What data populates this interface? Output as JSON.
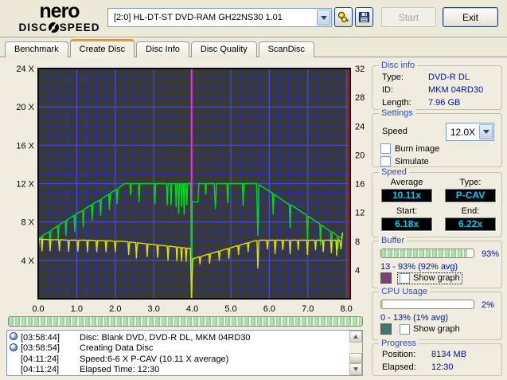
{
  "titlebar": {
    "brand": "nero",
    "product_left": "DISC",
    "product_right": "SPEED",
    "drive_selector": "[2:0]   HL-DT-ST DVD-RAM GH22NS30 1.01",
    "start_button": "Start",
    "exit_button": "Exit"
  },
  "tabs": [
    {
      "label": "Benchmark",
      "active": false
    },
    {
      "label": "Create Disc",
      "active": true
    },
    {
      "label": "Disc Info",
      "active": false
    },
    {
      "label": "Disc Quality",
      "active": false
    },
    {
      "label": "ScanDisc",
      "active": false
    }
  ],
  "chart_data": {
    "type": "line",
    "title": "",
    "x_axis": {
      "min": 0,
      "max": 8.1,
      "minor_step": 0.25,
      "major_step": 1,
      "ticks": [
        {
          "v": 0,
          "label": "0.0"
        },
        {
          "v": 1,
          "label": "1.0"
        },
        {
          "v": 2,
          "label": "2.0"
        },
        {
          "v": 3,
          "label": "3.0"
        },
        {
          "v": 4,
          "label": "4.0"
        },
        {
          "v": 5,
          "label": "5.0"
        },
        {
          "v": 6,
          "label": "6.0"
        },
        {
          "v": 7,
          "label": "7.0"
        },
        {
          "v": 8,
          "label": "8.0"
        }
      ]
    },
    "y_left_axis": {
      "min": 0,
      "max": 24,
      "minor_step": 1,
      "major_step": 4,
      "ticks": [
        {
          "v": 4,
          "label": "4 X"
        },
        {
          "v": 8,
          "label": "8 X"
        },
        {
          "v": 12,
          "label": "12 X"
        },
        {
          "v": 16,
          "label": "16 X"
        },
        {
          "v": 20,
          "label": "20 X"
        },
        {
          "v": 24,
          "label": "24 X"
        }
      ]
    },
    "y_right_axis": {
      "min": 0,
      "max": 32,
      "ticks": [
        {
          "v": 4,
          "label": "4"
        },
        {
          "v": 8,
          "label": "8"
        },
        {
          "v": 12,
          "label": "12"
        },
        {
          "v": 16,
          "label": "16"
        },
        {
          "v": 20,
          "label": "20"
        },
        {
          "v": 24,
          "label": "24"
        },
        {
          "v": 28,
          "label": "28"
        },
        {
          "v": 32,
          "label": "32"
        }
      ]
    },
    "grid": {
      "bg": "#3a3a35",
      "minor_color": "#2230b4",
      "major_color": "#3d4cf0",
      "border_color": "#05051e"
    },
    "markers": [
      {
        "name": "layer-break-line",
        "x": 3.98,
        "color": "#ff2ed8"
      },
      {
        "name": "end-of-disc-line",
        "x": 8.06,
        "color": "#dd1111"
      }
    ],
    "series": [
      {
        "name": "write-speed-x",
        "color": "#00dc14",
        "axis": "left",
        "points": [
          [
            0.0,
            5.0
          ],
          [
            0.03,
            6.3
          ],
          [
            0.08,
            6.5
          ],
          [
            0.1,
            5.4
          ],
          [
            0.12,
            6.6
          ],
          [
            0.29,
            7.0
          ],
          [
            0.31,
            5.7
          ],
          [
            0.33,
            7.1
          ],
          [
            0.5,
            7.6
          ],
          [
            0.52,
            6.1
          ],
          [
            0.54,
            7.7
          ],
          [
            0.7,
            8.1
          ],
          [
            0.72,
            6.6
          ],
          [
            0.74,
            8.2
          ],
          [
            0.93,
            8.7
          ],
          [
            0.95,
            7.0
          ],
          [
            0.97,
            8.8
          ],
          [
            1.15,
            9.2
          ],
          [
            1.17,
            7.5
          ],
          [
            1.19,
            9.3
          ],
          [
            1.38,
            9.8
          ],
          [
            1.4,
            8.2
          ],
          [
            1.42,
            9.9
          ],
          [
            1.6,
            10.3
          ],
          [
            1.62,
            8.7
          ],
          [
            1.64,
            10.4
          ],
          [
            1.83,
            10.9
          ],
          [
            1.85,
            9.3
          ],
          [
            1.87,
            11.0
          ],
          [
            2.03,
            11.4
          ],
          [
            2.05,
            9.9
          ],
          [
            2.07,
            11.5
          ],
          [
            2.25,
            12
          ],
          [
            2.38,
            12
          ],
          [
            2.4,
            10.8
          ],
          [
            2.42,
            12
          ],
          [
            2.6,
            12
          ],
          [
            2.62,
            10.1
          ],
          [
            2.64,
            12
          ],
          [
            3.01,
            12
          ],
          [
            3.03,
            9.9
          ],
          [
            3.05,
            12
          ],
          [
            3.33,
            12
          ],
          [
            3.35,
            9.8
          ],
          [
            3.37,
            12
          ],
          [
            3.43,
            12
          ],
          [
            3.45,
            9.8
          ],
          [
            3.47,
            12
          ],
          [
            3.56,
            12
          ],
          [
            3.58,
            9.6
          ],
          [
            3.6,
            12
          ],
          [
            3.63,
            12
          ],
          [
            3.65,
            8.9
          ],
          [
            3.67,
            12
          ],
          [
            3.7,
            12
          ],
          [
            3.72,
            9.6
          ],
          [
            3.74,
            12
          ],
          [
            3.77,
            12
          ],
          [
            3.79,
            8.8
          ],
          [
            3.81,
            12
          ],
          [
            3.84,
            12
          ],
          [
            3.86,
            9.8
          ],
          [
            3.88,
            12
          ],
          [
            3.96,
            12
          ],
          [
            3.98,
            0.2
          ],
          [
            4.0,
            10.1
          ],
          [
            4.15,
            10.1
          ],
          [
            4.17,
            12
          ],
          [
            4.33,
            12
          ],
          [
            4.35,
            10.9
          ],
          [
            4.37,
            12
          ],
          [
            4.57,
            12
          ],
          [
            4.6,
            9.4
          ],
          [
            4.63,
            12
          ],
          [
            4.9,
            12
          ],
          [
            4.92,
            10.0
          ],
          [
            4.94,
            12
          ],
          [
            5.3,
            12
          ],
          [
            5.32,
            9.7
          ],
          [
            5.34,
            12
          ],
          [
            5.67,
            12
          ],
          [
            5.7,
            6.6
          ],
          [
            5.73,
            11.9
          ],
          [
            6.08,
            11.0
          ],
          [
            6.1,
            8.8
          ],
          [
            6.12,
            10.9
          ],
          [
            6.52,
            9.8
          ],
          [
            6.54,
            7.4
          ],
          [
            6.56,
            9.8
          ],
          [
            6.97,
            8.7
          ],
          [
            6.99,
            6.1
          ],
          [
            7.01,
            8.6
          ],
          [
            7.31,
            7.8
          ],
          [
            7.33,
            5.6
          ],
          [
            7.35,
            7.7
          ],
          [
            7.59,
            7.0
          ],
          [
            7.61,
            5.2
          ],
          [
            7.63,
            7.0
          ],
          [
            7.76,
            6.6
          ],
          [
            7.78,
            5.2
          ],
          [
            7.8,
            6.5
          ],
          [
            7.87,
            6.3
          ],
          [
            7.9,
            6.8
          ]
        ]
      },
      {
        "name": "rotation-speed",
        "color": "#e0e000",
        "axis": "left",
        "points": [
          [
            0.0,
            4.9
          ],
          [
            0.02,
            6.2
          ],
          [
            0.08,
            6.2
          ],
          [
            0.1,
            5.0
          ],
          [
            0.12,
            6.2
          ],
          [
            0.29,
            6.15
          ],
          [
            0.31,
            5.0
          ],
          [
            0.33,
            6.15
          ],
          [
            0.53,
            6.15
          ],
          [
            0.55,
            5.0
          ],
          [
            0.57,
            6.15
          ],
          [
            0.77,
            6.1
          ],
          [
            0.79,
            4.95
          ],
          [
            0.81,
            6.1
          ],
          [
            1.01,
            6.1
          ],
          [
            1.03,
            4.95
          ],
          [
            1.05,
            6.1
          ],
          [
            1.26,
            6.1
          ],
          [
            1.28,
            4.9
          ],
          [
            1.3,
            6.1
          ],
          [
            1.5,
            6.05
          ],
          [
            1.52,
            4.9
          ],
          [
            1.54,
            6.05
          ],
          [
            1.74,
            6.05
          ],
          [
            1.76,
            4.9
          ],
          [
            1.78,
            6.05
          ],
          [
            1.98,
            6.0
          ],
          [
            2.0,
            4.9
          ],
          [
            2.02,
            6.0
          ],
          [
            2.17,
            6.0
          ],
          [
            2.33,
            5.93
          ],
          [
            2.35,
            4.6
          ],
          [
            2.37,
            5.92
          ],
          [
            2.53,
            5.84
          ],
          [
            2.55,
            4.25
          ],
          [
            2.57,
            5.83
          ],
          [
            2.81,
            5.72
          ],
          [
            2.83,
            4.4
          ],
          [
            2.85,
            5.71
          ],
          [
            3.08,
            5.6
          ],
          [
            3.1,
            4.3
          ],
          [
            3.12,
            5.6
          ],
          [
            3.35,
            5.49
          ],
          [
            3.37,
            4.0
          ],
          [
            3.39,
            5.48
          ],
          [
            3.58,
            5.39
          ],
          [
            3.6,
            3.95
          ],
          [
            3.62,
            5.38
          ],
          [
            3.7,
            5.34
          ],
          [
            3.72,
            3.9
          ],
          [
            3.74,
            5.33
          ],
          [
            3.82,
            5.29
          ],
          [
            3.84,
            3.9
          ],
          [
            3.86,
            5.28
          ],
          [
            3.95,
            5.25
          ],
          [
            3.98,
            0.1
          ],
          [
            4.01,
            4.15
          ],
          [
            4.18,
            4.38
          ],
          [
            4.2,
            3.6
          ],
          [
            4.22,
            4.4
          ],
          [
            4.43,
            4.67
          ],
          [
            4.45,
            3.7
          ],
          [
            4.47,
            4.69
          ],
          [
            4.68,
            4.96
          ],
          [
            4.7,
            4.0
          ],
          [
            4.72,
            4.98
          ],
          [
            4.93,
            5.25
          ],
          [
            4.95,
            4.2
          ],
          [
            4.97,
            5.27
          ],
          [
            5.18,
            5.54
          ],
          [
            5.2,
            4.6
          ],
          [
            5.22,
            5.56
          ],
          [
            5.43,
            5.83
          ],
          [
            5.45,
            4.9
          ],
          [
            5.47,
            5.85
          ],
          [
            5.62,
            6.05
          ],
          [
            5.68,
            6.05
          ],
          [
            5.7,
            3.2
          ],
          [
            5.73,
            6.1
          ],
          [
            5.93,
            6.1
          ],
          [
            5.95,
            5.2
          ],
          [
            5.97,
            6.1
          ],
          [
            6.13,
            6.1
          ],
          [
            6.15,
            4.7
          ],
          [
            6.17,
            6.1
          ],
          [
            6.33,
            6.1
          ],
          [
            6.35,
            5.1
          ],
          [
            6.37,
            6.1
          ],
          [
            6.52,
            6.1
          ],
          [
            6.54,
            4.7
          ],
          [
            6.56,
            6.1
          ],
          [
            6.73,
            6.1
          ],
          [
            6.75,
            5.1
          ],
          [
            6.77,
            6.1
          ],
          [
            6.97,
            6.1
          ],
          [
            6.99,
            4.6
          ],
          [
            7.01,
            6.1
          ],
          [
            7.18,
            6.1
          ],
          [
            7.2,
            5.1
          ],
          [
            7.22,
            6.1
          ],
          [
            7.38,
            6.1
          ],
          [
            7.4,
            4.9
          ],
          [
            7.42,
            6.1
          ],
          [
            7.59,
            6.1
          ],
          [
            7.61,
            4.8
          ],
          [
            7.63,
            6.1
          ],
          [
            7.73,
            6.1
          ],
          [
            7.75,
            4.5
          ],
          [
            7.77,
            6.1
          ],
          [
            7.83,
            6.1
          ],
          [
            7.86,
            5.2
          ],
          [
            7.9,
            6.9
          ]
        ]
      }
    ]
  },
  "sidebar": {
    "disc_info": {
      "title": "Disc info",
      "type_label": "Type:",
      "type_value": "DVD-R DL",
      "id_label": "ID:",
      "id_value": "MKM 04RD30",
      "length_label": "Length:",
      "length_value": "7.96 GB"
    },
    "settings": {
      "title": "Settings",
      "speed_label": "Speed",
      "speed_value": "12.0X",
      "burn_image_label": "Burn image",
      "burn_image_checked": false,
      "simulate_label": "Simulate",
      "simulate_checked": false
    },
    "speed": {
      "title": "Speed",
      "average_label": "Average",
      "average_value": "10.11x",
      "type_label": "Type:",
      "type_value": "P-CAV",
      "start_label": "Start:",
      "start_value": "6.18x",
      "end_label": "End:",
      "end_value": "6.22x",
      "lcd_text_color": "#00c8f0"
    },
    "buffer": {
      "title": "Buffer",
      "percent": 93,
      "percent_label": "93%",
      "range_label": "13 - 93% (92% avg)",
      "show_graph_label": "Show graph",
      "show_graph_checked": false,
      "swatch_color": "#7e4079"
    },
    "cpu": {
      "title": "CPU Usage",
      "percent": 2,
      "percent_label": "2%",
      "range_label": "0 - 13% (1% avg)",
      "show_graph_label": "Show graph",
      "show_graph_checked": false,
      "swatch_color": "#3d7a6b"
    },
    "progress": {
      "title": "Progress",
      "position_label": "Position:",
      "position_value": "8134 MB",
      "elapsed_label": "Elapsed:",
      "elapsed_value": "12:30"
    }
  },
  "burn_progress": {
    "percent": 100
  },
  "log": {
    "entries": [
      {
        "icon": true,
        "time": "[03:58:44]",
        "text": "Disc: Blank DVD, DVD-R DL, MKM 04RD30"
      },
      {
        "icon": true,
        "time": "[03:58:54]",
        "text": "Creating Data Disc"
      },
      {
        "icon": false,
        "time": "[04:11:24]",
        "text": "Speed:6-6 X P-CAV (10.11 X average)"
      },
      {
        "icon": false,
        "time": "[04:11:24]",
        "text": "Elapsed Time: 12:30"
      }
    ]
  }
}
